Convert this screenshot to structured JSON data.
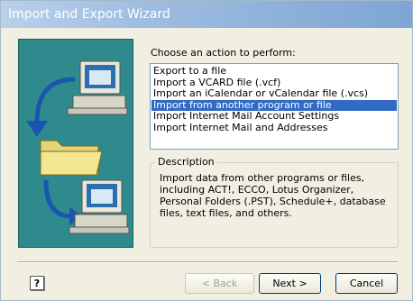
{
  "window": {
    "title": "Import and Export Wizard"
  },
  "main": {
    "prompt": "Choose an action to perform:",
    "actions": [
      "Export to a file",
      "Import a VCARD file (.vcf)",
      "Import an iCalendar or vCalendar file (.vcs)",
      "Import from another program or file",
      "Import Internet Mail Account Settings",
      "Import Internet Mail and Addresses"
    ],
    "selected_action": "Import from another program or file",
    "description_label": "Description",
    "description_text": "Import data from other programs or files, including ACT!, ECCO, Lotus Organizer, Personal Folders (.PST), Schedule+, database files, text files, and others."
  },
  "footer": {
    "help_icon": "help-icon",
    "help_glyph": "?",
    "back_label": "< Back",
    "next_label": "Next >",
    "cancel_label": "Cancel"
  },
  "colors": {
    "selection": "#316ac5",
    "art_background": "#2f8a8d",
    "arrow": "#1a56b0"
  }
}
